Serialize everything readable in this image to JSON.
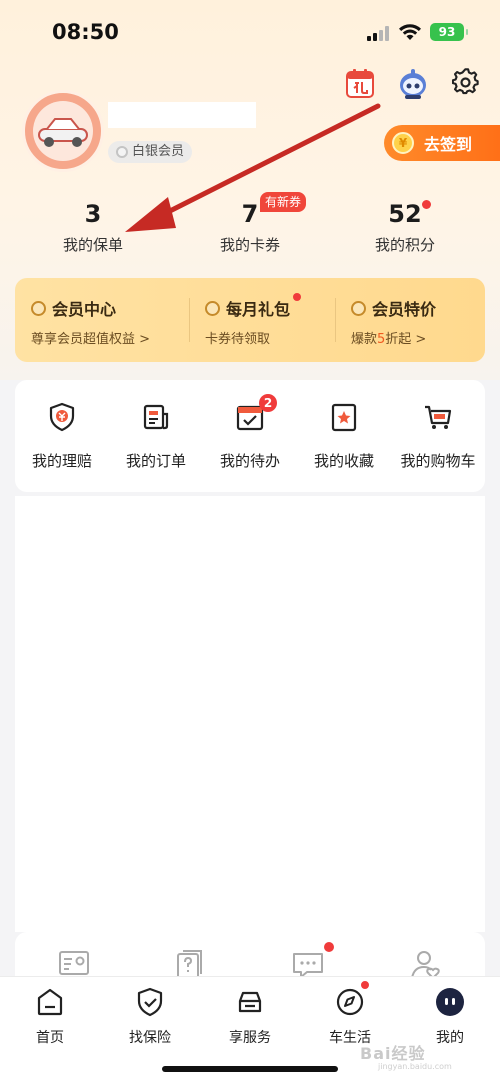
{
  "status_bar": {
    "time": "08:50",
    "battery": "93"
  },
  "profile": {
    "level_badge": "白银会员",
    "signin_button": "去签到"
  },
  "stats": [
    {
      "value": "3",
      "label": "我的保单"
    },
    {
      "value": "7",
      "label": "我的卡券"
    },
    {
      "value": "52",
      "label": "我的积分"
    }
  ],
  "new_badge": "有新券",
  "vip_card": [
    {
      "title": "会员中心",
      "subtitle": "尊享会员超值权益 >"
    },
    {
      "title": "每月礼包",
      "subtitle": "卡券待领取"
    },
    {
      "title": "会员特价",
      "subtitle_prefix": "爆款",
      "subtitle_highlight": "5",
      "subtitle_suffix": "折起 >"
    }
  ],
  "quick_actions": [
    {
      "label": "我的理赔",
      "icon": "shield-icon"
    },
    {
      "label": "我的订单",
      "icon": "order-icon"
    },
    {
      "label": "我的待办",
      "icon": "todo-icon",
      "badge": "2"
    },
    {
      "label": "我的收藏",
      "icon": "bookmark-icon"
    },
    {
      "label": "我的购物车",
      "icon": "cart-icon"
    }
  ],
  "tabs": [
    {
      "label": "首页",
      "icon": "home-icon"
    },
    {
      "label": "找保险",
      "icon": "insurance-shield-icon"
    },
    {
      "label": "享服务",
      "icon": "car-service-icon"
    },
    {
      "label": "车生活",
      "icon": "compass-icon"
    },
    {
      "label": "我的",
      "icon": "profile-icon"
    }
  ],
  "watermark": {
    "text": "Bai经验",
    "sub": "jingyan.baidu.com"
  },
  "colors": {
    "accent": "#ff7a1f",
    "badge_red": "#f03b3b",
    "vip_gold": "#ffd98e"
  }
}
